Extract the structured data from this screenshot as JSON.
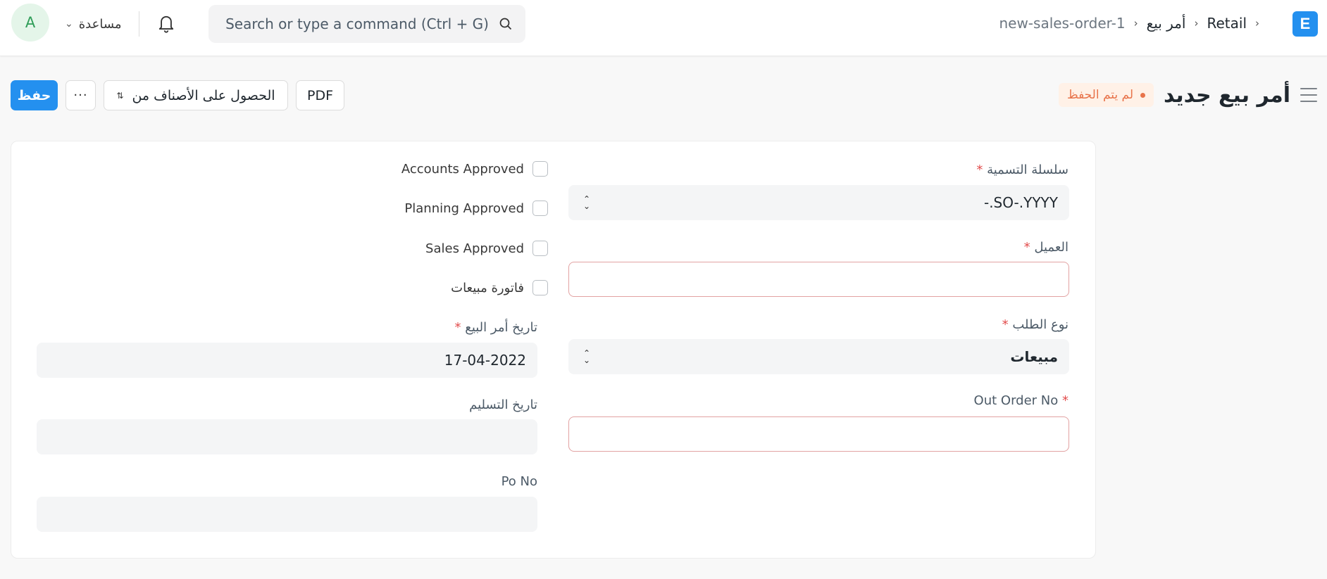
{
  "navbar": {
    "avatar_initial": "A",
    "help_label": "مساعدة",
    "search_placeholder": "Search or type a command (Ctrl + G)",
    "breadcrumbs": [
      "Retail",
      "أمر بيع",
      "new-sales-order-1"
    ],
    "app_logo_letter": "E"
  },
  "page": {
    "title": "أمر بيع جديد",
    "status": "لم يتم الحفظ",
    "buttons": {
      "save": "حفظ",
      "more": "···",
      "get_items_from": "الحصول على الأصناف من",
      "pdf": "PDF"
    }
  },
  "form": {
    "naming_series": {
      "label": "سلسلة التسمية",
      "value": "-.SO-.YYYY"
    },
    "customer": {
      "label": "العميل",
      "value": ""
    },
    "order_type": {
      "label": "نوع الطلب",
      "value": "مبيعات"
    },
    "out_order_no": {
      "label": "Out Order No",
      "value": ""
    },
    "checkboxes": [
      {
        "label": "Accounts Approved",
        "checked": false
      },
      {
        "label": "Planning Approved",
        "checked": false
      },
      {
        "label": "Sales Approved",
        "checked": false
      },
      {
        "label": "فاتورة مبيعات",
        "checked": false
      }
    ],
    "transaction_date": {
      "label": "تاريخ أمر البيع",
      "value": "17-04-2022"
    },
    "delivery_date": {
      "label": "تاريخ التسليم",
      "value": ""
    },
    "po_no": {
      "label": "Po No",
      "value": ""
    },
    "required_mark": "*"
  },
  "colors": {
    "primary": "#2490ef",
    "status_orange": "#e8734a",
    "required_red": "#e24c4c"
  }
}
